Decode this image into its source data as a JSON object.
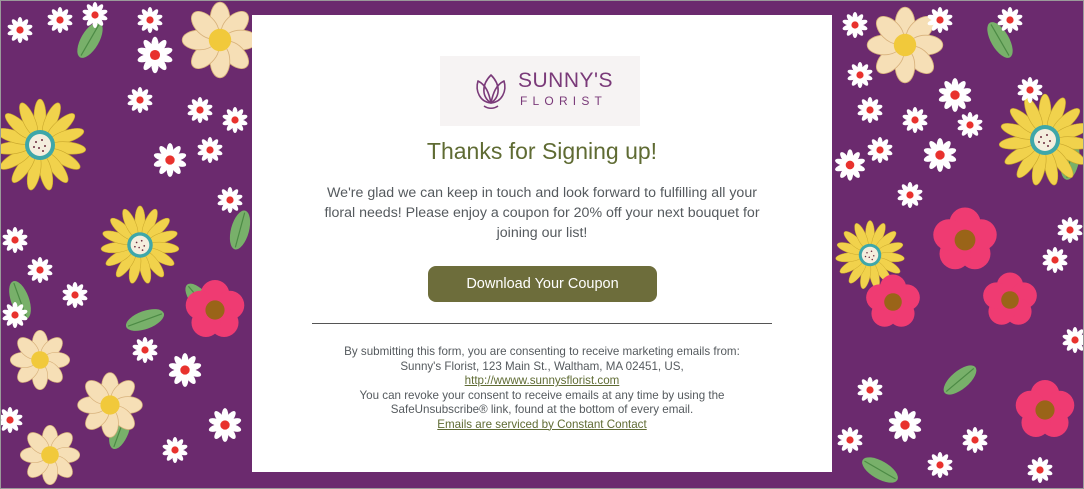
{
  "logo": {
    "line1": "SUNNY'S",
    "line2": "FLORIST"
  },
  "title": "Thanks for Signing up!",
  "message": "We're glad we can keep in touch and look forward to fulfilling all your floral needs! Please enjoy a coupon for 20% off your next bouquet for joining our list!",
  "cta_label": "Download Your Coupon",
  "consent": {
    "line1": "By submitting this form, you are consenting to receive marketing emails from:",
    "line2": "Sunny's Florist, 123 Main St., Waltham, MA 02451, US,",
    "website_link": "http://wwww.sunnysflorist.com",
    "line4": "You can revoke your consent to receive emails at any time by using the",
    "line5": "SafeUnsubscribe® link, found at the bottom of every email.",
    "service_link": "Emails are serviced by Constant Contact"
  },
  "colors": {
    "background_purple": "#6b2a6e",
    "title_olive": "#5f6b33",
    "button_olive": "#6d6d3b",
    "logo_purple": "#7a3a79"
  }
}
